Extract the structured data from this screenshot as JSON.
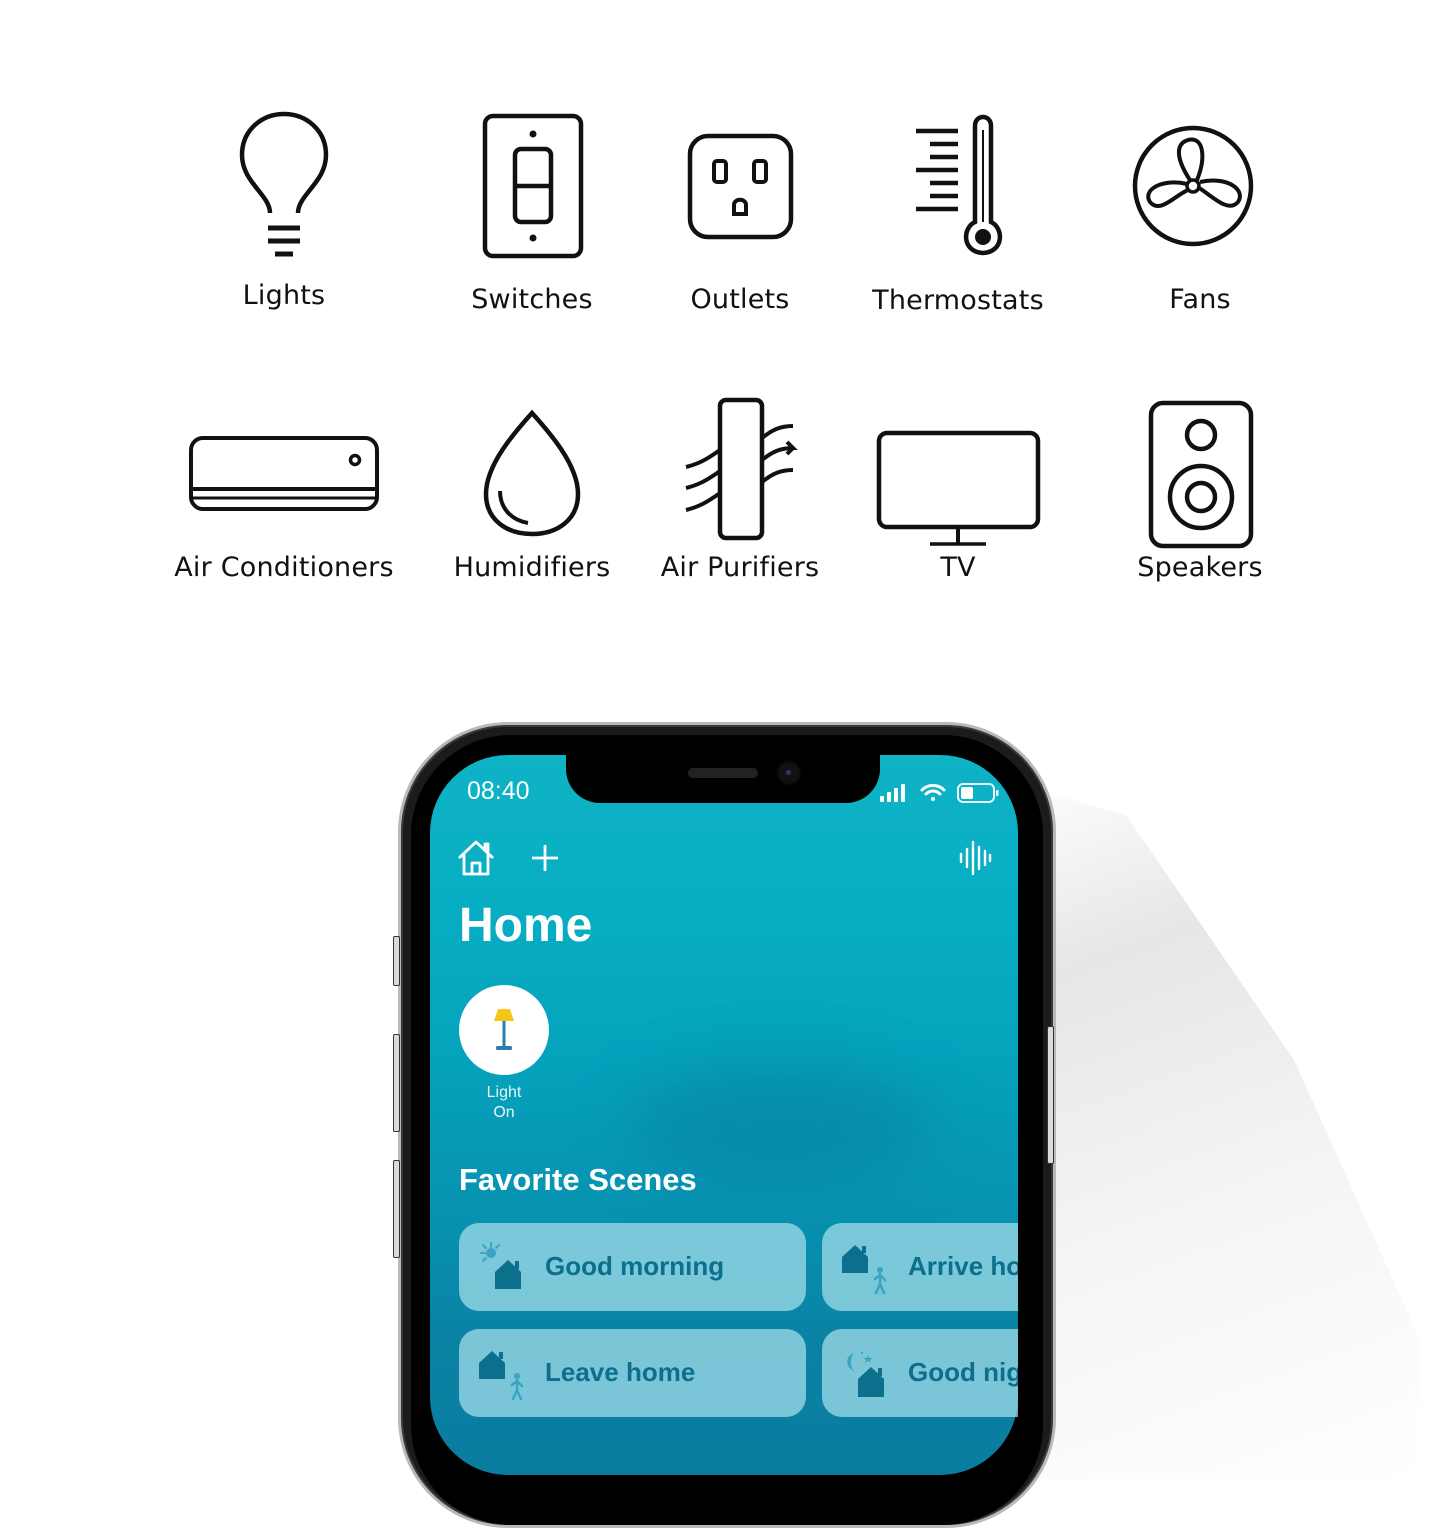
{
  "categories": {
    "row1": [
      {
        "label": "Lights",
        "icon": "light-bulb-icon"
      },
      {
        "label": "Switches",
        "icon": "wall-switch-icon"
      },
      {
        "label": "Outlets",
        "icon": "power-outlet-icon"
      },
      {
        "label": "Thermostats",
        "icon": "thermometer-icon"
      },
      {
        "label": "Fans",
        "icon": "fan-icon"
      }
    ],
    "row2": [
      {
        "label": "Air Conditioners",
        "icon": "air-conditioner-icon"
      },
      {
        "label": "Humidifiers",
        "icon": "water-drop-icon"
      },
      {
        "label": "Air Purifiers",
        "icon": "air-purifier-icon"
      },
      {
        "label": "TV",
        "icon": "tv-icon"
      },
      {
        "label": "Speakers",
        "icon": "speaker-icon"
      }
    ]
  },
  "phone": {
    "status_bar": {
      "time": "08:40",
      "icons": [
        "cellular-signal-icon",
        "wifi-icon",
        "battery-icon"
      ]
    },
    "toolbar": {
      "icons": [
        "home-icon",
        "add-icon",
        "voice-waveform-icon"
      ]
    },
    "title": "Home",
    "accessory": {
      "name": "Light",
      "state": "On",
      "icon": "floor-lamp-icon"
    },
    "favorite_scenes": {
      "title": "Favorite Scenes",
      "scenes": [
        {
          "label": "Good morning",
          "icon": "sun-house-icon"
        },
        {
          "label": "Arrive home",
          "icon": "house-person-icon"
        },
        {
          "label": "Leave home",
          "icon": "house-person-icon"
        },
        {
          "label": "Good night",
          "icon": "moon-house-icon"
        }
      ]
    }
  },
  "colors": {
    "screen_top": "#0fb3c6",
    "screen_bottom": "#0a7ca0",
    "tile_bg": "#a0dce8",
    "tile_text": "#0c6f8c",
    "lamp_shade": "#f5c518",
    "lamp_stand": "#2a7fb0"
  }
}
